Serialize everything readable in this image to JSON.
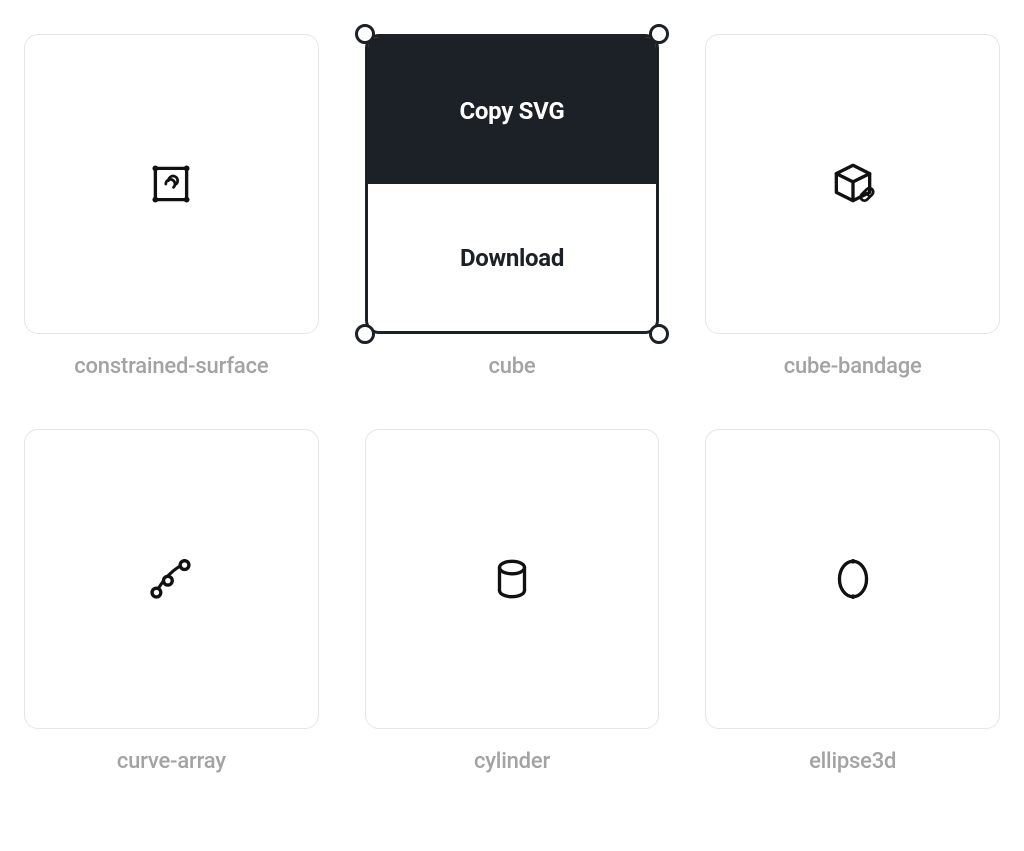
{
  "overlay": {
    "copy_svg": "Copy SVG",
    "download": "Download"
  },
  "icons": [
    {
      "key": "constrained-surface",
      "label": "constrained-surface"
    },
    {
      "key": "cube",
      "label": "cube",
      "selected": true
    },
    {
      "key": "cube-bandage",
      "label": "cube-bandage"
    },
    {
      "key": "curve-array",
      "label": "curve-array"
    },
    {
      "key": "cylinder",
      "label": "cylinder"
    },
    {
      "key": "ellipse3d",
      "label": "ellipse3d"
    }
  ]
}
